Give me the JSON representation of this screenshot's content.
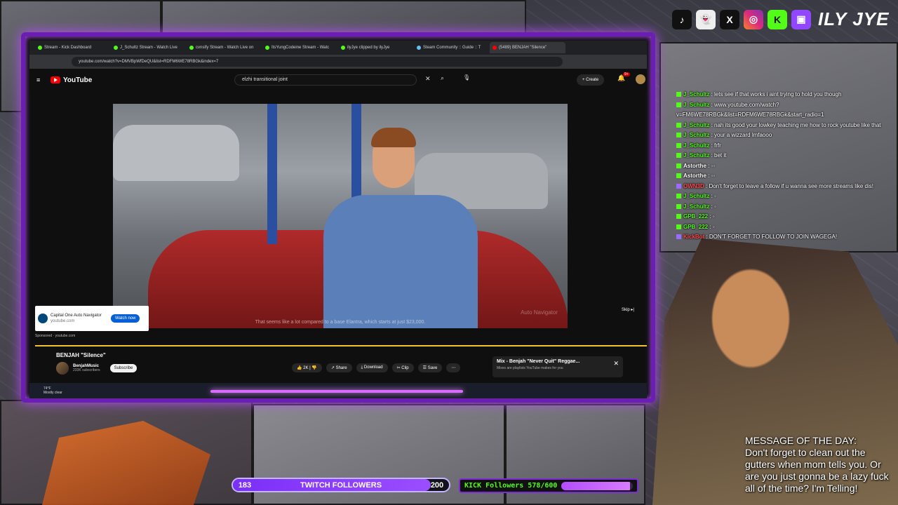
{
  "browser": {
    "tabs": [
      {
        "label": "Stream - Kick Dashboard",
        "color": "#53fc18"
      },
      {
        "label": "J_Schultz Stream - Watch Live",
        "color": "#53fc18"
      },
      {
        "label": "cvnsify Stream - Watch Live on",
        "color": "#53fc18"
      },
      {
        "label": "ItsYungCodeine Stream - Watc",
        "color": "#53fc18"
      },
      {
        "label": "ilyJye clipped by ilyJye",
        "color": "#53fc18"
      },
      {
        "label": "Steam Community :: Guide :: T",
        "color": "#66c0f4"
      },
      {
        "label": "(5489) BENJAH \"Silence\"",
        "color": "#ff0000"
      }
    ],
    "url": "youtube.com/watch?v=DMVBpWfDeQU&list=RDFM6WE78RBGk&index=7"
  },
  "youtube": {
    "logo": "YouTube",
    "search_value": "elzhi transitional joint",
    "create_label": "+ Create",
    "notifications": "9+",
    "video_subtitle": "That seems like a lot compared to a base Elantra, which starts at just $23,000.",
    "watermark": "Auto Navigator",
    "ad": {
      "name": "Capital One Auto Navigator",
      "domain": "youtube.com",
      "button": "Watch now",
      "sponsored": "Sponsored · youtube.com",
      "skip": "Skip ▸|"
    },
    "video_title": "BENJAH \"Silence\"",
    "channel": {
      "name": "BenjahMusic",
      "subs": "233K subscribers",
      "subscribe": "Subscribe"
    },
    "actions": {
      "likes": "2K",
      "share": "Share",
      "download": "Download",
      "clip": "Clip",
      "save": "Save"
    },
    "mix": {
      "title": "Mix - Benjah \"Never Quit\" Reggae...",
      "subtitle": "Mixes are playlists YouTube makes for you"
    }
  },
  "taskbar": {
    "temp": "74°F",
    "condition": "Mostly clear"
  },
  "social": {
    "handle": "ILY JYE"
  },
  "chat": [
    {
      "user": "J_Schultz",
      "color": "#53fc18",
      "msg": "lets see if that works i aint trying to hold you though",
      "badge": "kick"
    },
    {
      "user": "J_Schultz",
      "color": "#53fc18",
      "msg": "www.youtube.com/watch?v=FM6WE78RBGk&list=RDFM6WE78RBGk&start_radio=1",
      "badge": "kick"
    },
    {
      "user": "J_Schultz",
      "color": "#53fc18",
      "msg": "nah its good your lowkey teaching me how to rock youtube like that",
      "badge": "kick"
    },
    {
      "user": "J_Schultz",
      "color": "#53fc18",
      "msg": "your a wizzard lmfaooo",
      "badge": "kick"
    },
    {
      "user": "J_Schultz",
      "color": "#53fc18",
      "msg": "frfr",
      "badge": "kick"
    },
    {
      "user": "J_Schultz",
      "color": "#53fc18",
      "msg": "bet it",
      "badge": "kick"
    },
    {
      "user": "Astorthe",
      "color": "#ffffff",
      "msg": "◦◦",
      "badge": "kick"
    },
    {
      "user": "Astorthe",
      "color": "#ffffff",
      "msg": "◦◦",
      "badge": "kick"
    },
    {
      "user": "OWN3D",
      "color": "#ff4d4d",
      "msg": "Don't forget to leave a follow if u wanna see more streams like dis!",
      "badge": "bot"
    },
    {
      "user": "J_Schultz",
      "color": "#53fc18",
      "msg": "◦",
      "badge": "kick"
    },
    {
      "user": "J_Schultz",
      "color": "#53fc18",
      "msg": "◦",
      "badge": "kick"
    },
    {
      "user": "GPB_222",
      "color": "#53fc18",
      "msg": "◦",
      "badge": "kick"
    },
    {
      "user": "GPB_222",
      "color": "#53fc18",
      "msg": "◦",
      "badge": "kick"
    },
    {
      "user": "KickBot",
      "color": "#ff4d4d",
      "msg": "DON'T FORGET TO FOLLOW TO JOIN WAGEGA!",
      "badge": "bot"
    }
  ],
  "motd": {
    "heading": "MESSAGE OF THE DAY:",
    "body": "Don't forget to clean out the gutters when mom tells you. Or are you just gonna be a lazy fuck all of the time? I'm Telling!"
  },
  "twitch_goal": {
    "current": "183",
    "label": "TWITCH FOLLOWERS",
    "target": "200",
    "progress": 0.915
  },
  "kick_goal": {
    "label": "KICK Followers 578/600",
    "progress": 0.963
  }
}
